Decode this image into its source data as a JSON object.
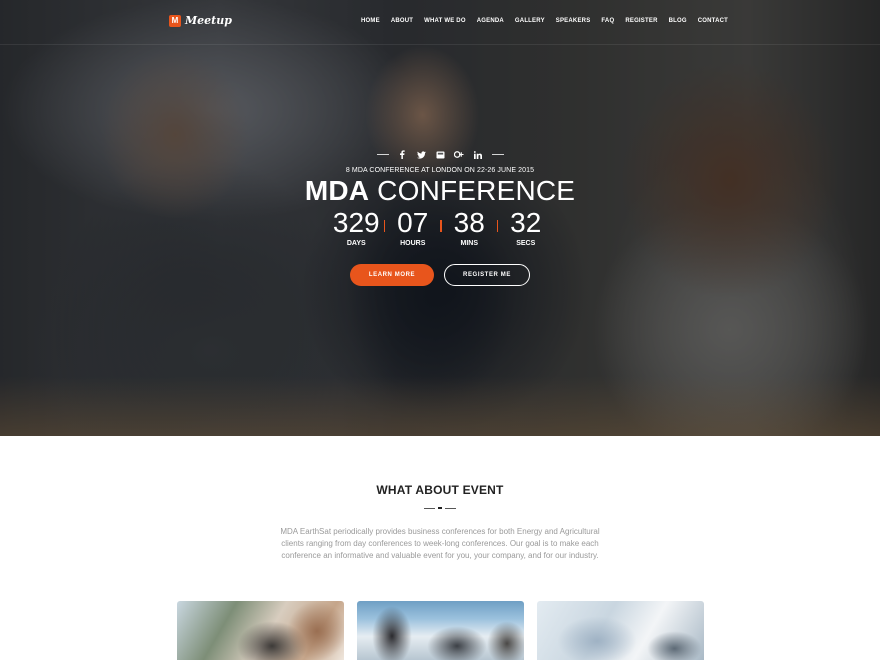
{
  "nav": {
    "logo_mark": "M",
    "logo_text": "Meetup",
    "items": [
      "HOME",
      "ABOUT",
      "WHAT WE DO",
      "AGENDA",
      "GALLERY",
      "SPEAKERS",
      "FAQ",
      "REGISTER",
      "BLOG",
      "CONTACT"
    ]
  },
  "hero": {
    "social_icons": [
      "facebook-icon",
      "twitter-icon",
      "email-icon",
      "google-plus-icon",
      "linkedin-icon"
    ],
    "subtitle": "8 MDA CONFERENCE AT LONDON ON 22-26 JUNE 2015",
    "title_bold": "MDA",
    "title_light": "CONFERENCE",
    "countdown": [
      {
        "value": "329",
        "label": "DAYS"
      },
      {
        "value": "07",
        "label": "HOURS"
      },
      {
        "value": "38",
        "label": "MINS"
      },
      {
        "value": "32",
        "label": "SECS"
      }
    ],
    "learn_more": "LEARN MORE",
    "register": "REGISTER ME"
  },
  "about": {
    "title": "WHAT ABOUT EVENT",
    "description": "MDA EarthSat periodically provides business conferences for both Energy and Agricultural clients ranging from day conferences to week-long conferences. Our goal is to make each conference an informative and valuable event for you, your company, and for our industry."
  },
  "colors": {
    "accent": "#e8551c",
    "heading": "#222222",
    "body_text": "#9a9a9a"
  }
}
